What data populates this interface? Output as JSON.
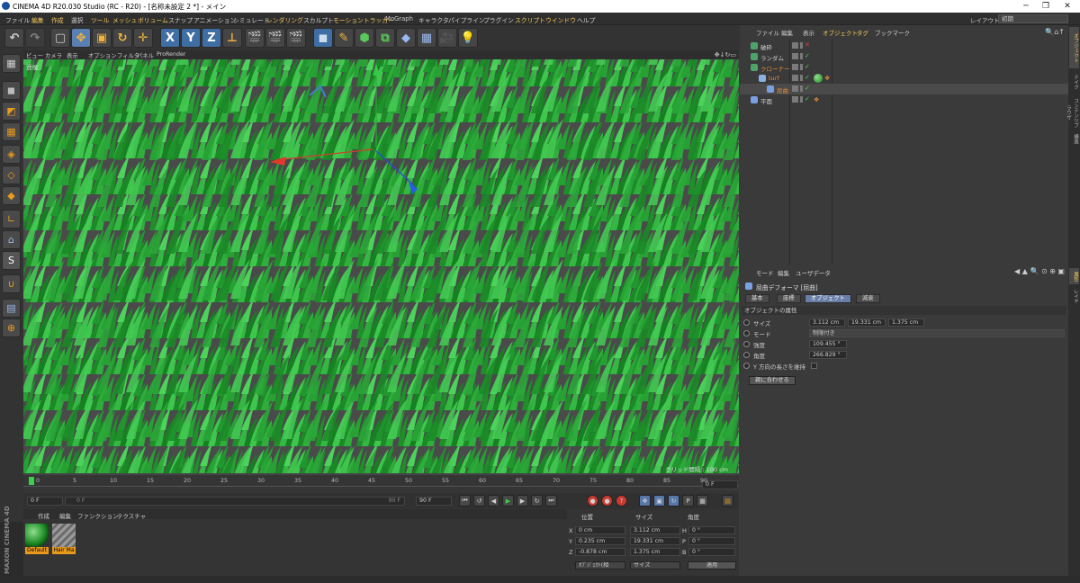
{
  "window": {
    "title": "CINEMA 4D R20.030 Studio (RC - R20) - [名称未設定 2 *] - メイン"
  },
  "menubar": {
    "items": [
      {
        "label": "ファイル",
        "hl": false
      },
      {
        "label": "編集",
        "hl": true
      },
      {
        "label": "作成",
        "hl": true
      },
      {
        "label": "選択",
        "hl": false
      },
      {
        "label": "ツール",
        "hl": true
      },
      {
        "label": "メッシュ",
        "hl": true
      },
      {
        "label": "ボリューム",
        "hl": true
      },
      {
        "label": "スナップ",
        "hl": false
      },
      {
        "label": "アニメーション",
        "hl": false
      },
      {
        "label": "シミュレート",
        "hl": false
      },
      {
        "label": "レンダリング",
        "hl": true
      },
      {
        "label": "スカルプト",
        "hl": false
      },
      {
        "label": "モーショントラッカー",
        "hl": true
      },
      {
        "label": "MoGraph",
        "hl": false
      },
      {
        "label": "キャラクタ",
        "hl": false
      },
      {
        "label": "パイプライン",
        "hl": false
      },
      {
        "label": "プラグイン",
        "hl": false
      },
      {
        "label": "スクリプト",
        "hl": true
      },
      {
        "label": "ウインドウ",
        "hl": true
      },
      {
        "label": "ヘルプ",
        "hl": false
      }
    ],
    "layout_label": "レイアウト:",
    "layout_value": "初期"
  },
  "viewport": {
    "menu": [
      "ビュー",
      "カメラ",
      "表示",
      "オプション",
      "フィルタ",
      "パネル",
      "ProRender"
    ],
    "camera_label": "透視",
    "grid_info": "グリッド間隔 : 100 cm"
  },
  "timeline": {
    "ticks": [
      "0",
      "5",
      "10",
      "15",
      "20",
      "25",
      "30",
      "35",
      "40",
      "45",
      "50",
      "55",
      "60",
      "65",
      "70",
      "75",
      "80",
      "85",
      "90"
    ],
    "current_frame": "0 F"
  },
  "playbar": {
    "start": "0 F",
    "slider_start": "0 F",
    "slider_end": "90 F",
    "end": "90 F"
  },
  "material_panel": {
    "menu": [
      "作成",
      "編集",
      "ファンクション",
      "テクスチャ"
    ],
    "materials": [
      {
        "name": "Default"
      },
      {
        "name": "Hair Ma"
      }
    ]
  },
  "coordinates": {
    "headers": [
      "位置",
      "サイズ",
      "角度"
    ],
    "rows": [
      {
        "axis": "X",
        "pos": "0 cm",
        "size": "3.112 cm",
        "rot_label": "H",
        "rot": "0 °"
      },
      {
        "axis": "Y",
        "pos": "0.235 cm",
        "size": "19.331 cm",
        "rot_label": "P",
        "rot": "0 °"
      },
      {
        "axis": "Z",
        "pos": "-0.878 cm",
        "size": "1.375 cm",
        "rot_label": "B",
        "rot": "0 °"
      }
    ],
    "mode_select": "ｵﾌﾞｼﾞｪｸﾄ(相",
    "size_select": "サイズ",
    "apply_label": "適用"
  },
  "object_manager": {
    "menu": [
      {
        "label": "ファイル",
        "hl": false
      },
      {
        "label": "編集",
        "hl": false
      },
      {
        "label": "表示",
        "hl": false
      },
      {
        "label": "オブジェクト",
        "hl": true
      },
      {
        "label": "タグ",
        "hl": true
      },
      {
        "label": "ブックマーク",
        "hl": false
      }
    ],
    "objects": [
      {
        "name": "破砕",
        "indent": 0,
        "color": "#7fd0a0",
        "name_color": "#d0d0d0",
        "icon_color": "#4ea36a",
        "check": "x"
      },
      {
        "name": "ランダム",
        "indent": 0,
        "color": "#7fd0a0",
        "name_color": "#d0d0d0",
        "icon_color": "#4ea36a",
        "check": "v"
      },
      {
        "name": "クローナー",
        "indent": 0,
        "color": "#7fd0a0",
        "name_color": "#e38a3a",
        "icon_color": "#4ea36a",
        "check": "v"
      },
      {
        "name": "turf",
        "indent": 1,
        "color": "#7fd0a0",
        "name_color": "#e38a3a",
        "icon_color": "#8ab0e0",
        "check": "v"
      },
      {
        "name": "屈曲",
        "indent": 2,
        "color": "#7fd0a0",
        "name_color": "#e38a3a",
        "icon_color": "#7aa0e0",
        "check": "v"
      },
      {
        "name": "平面",
        "indent": 0,
        "color": "#7fd0a0",
        "name_color": "#d0d0d0",
        "icon_color": "#7aa0e0",
        "check": "v"
      }
    ]
  },
  "right_tabs": [
    "オブジェクト",
    "テイク",
    "コンテンツブラウザ",
    "構造"
  ],
  "right_tabs_lower": [
    "属性",
    "レイヤ"
  ],
  "attributes": {
    "menu": [
      "モード",
      "編集",
      "ユーザデータ"
    ],
    "object_title": "屈曲デフォーマ [屈曲]",
    "tabs": [
      {
        "label": "基本",
        "active": false
      },
      {
        "label": "座標",
        "active": false
      },
      {
        "label": "オブジェクト",
        "active": true
      },
      {
        "label": "減衰",
        "active": false
      }
    ],
    "section": "オブジェクトの属性",
    "size_label": "サイズ",
    "size_x": "3.112 cm",
    "size_y": "19.331 cm",
    "size_z": "1.375 cm",
    "mode_label": "モード",
    "mode_value": "制限付き",
    "strength_label": "強度",
    "strength_value": "109.455 °",
    "angle_label": "角度",
    "angle_value": "266.829 °",
    "keep_y_label": "Y 方向の長さを維持",
    "fit_button": "親に合わせる"
  }
}
